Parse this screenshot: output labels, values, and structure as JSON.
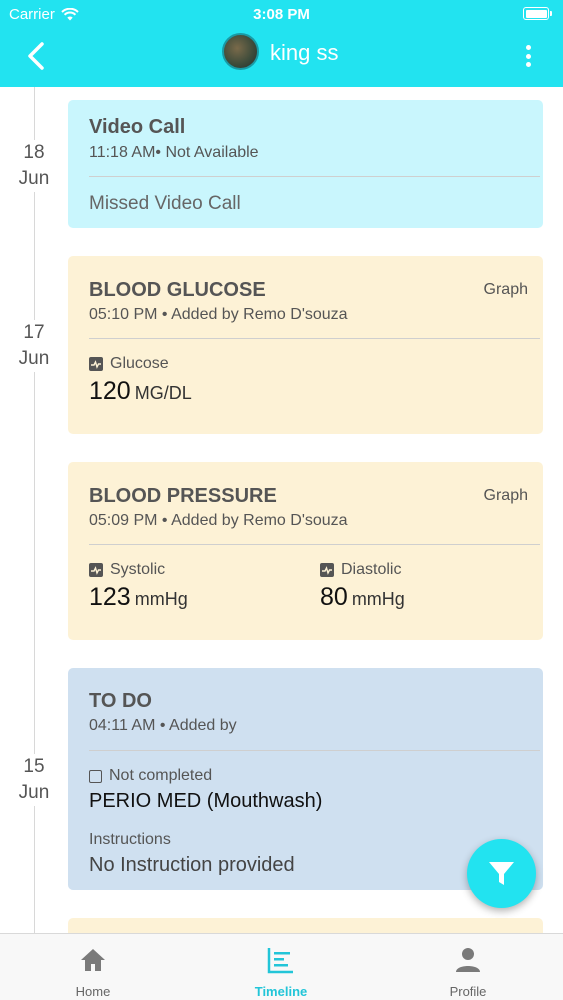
{
  "status_bar": {
    "carrier": "Carrier",
    "time": "3:08 PM"
  },
  "header": {
    "title": "king ss"
  },
  "timeline": {
    "dates": [
      {
        "day": "18",
        "month": "Jun"
      },
      {
        "day": "17",
        "month": "Jun"
      },
      {
        "day": "15",
        "month": "Jun"
      }
    ],
    "video_call": {
      "title": "Video Call",
      "meta": "11:18 AM• Not Available",
      "body": "Missed Video Call",
      "color": "#c9f6fd"
    },
    "blood_glucose": {
      "title": "BLOOD GLUCOSE",
      "meta": "05:10 PM • Added by  Remo  D'souza",
      "graph_label": "Graph",
      "reading_label": "Glucose",
      "reading_value": "120",
      "reading_unit": "MG/DL",
      "color": "#fdf2d6"
    },
    "blood_pressure": {
      "title": "BLOOD PRESSURE",
      "meta": "05:09 PM • Added by  Remo  D'souza",
      "graph_label": "Graph",
      "systolic_label": "Systolic",
      "systolic_value": "123",
      "systolic_unit": "mmHg",
      "diastolic_label": "Diastolic",
      "diastolic_value": "80",
      "diastolic_unit": "mmHg",
      "color": "#fdf2d6"
    },
    "todo": {
      "title": "TO DO",
      "meta": "04:11 AM • Added by",
      "status": "Not completed",
      "task": "PERIO MED (Mouthwash)",
      "instructions_label": "Instructions",
      "instructions_value": "No Instruction provided",
      "color": "#cfe0f0"
    }
  },
  "bottom_nav": {
    "items": [
      {
        "label": "Home",
        "icon": "home-icon"
      },
      {
        "label": "Timeline",
        "icon": "timeline-icon"
      },
      {
        "label": "Profile",
        "icon": "profile-icon"
      }
    ],
    "active": "Timeline"
  },
  "colors": {
    "accent": "#22e3f0",
    "active_nav": "#22c5d8"
  }
}
